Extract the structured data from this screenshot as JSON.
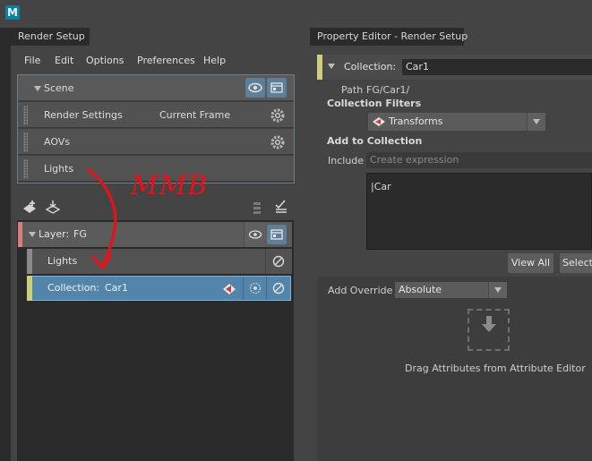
{
  "app": {
    "logo_letter": "M"
  },
  "tabs": {
    "render_setup": "Render Setup",
    "property_editor": "Property Editor - Render Setup"
  },
  "menu": [
    "File",
    "Edit",
    "Options",
    "Preferences",
    "Help"
  ],
  "scene": {
    "label": "Scene",
    "rows": [
      {
        "label": "Render Settings",
        "value": "Current Frame"
      },
      {
        "label": "AOVs"
      },
      {
        "label": "Lights"
      }
    ]
  },
  "annotation": {
    "text": "MMB",
    "color": "#e8101a"
  },
  "layers": {
    "layer_prefix": "Layer:",
    "layer_name": "FG",
    "sub_lights": "Lights",
    "collection_prefix": "Collection:",
    "collection_name": "Car1"
  },
  "property_editor": {
    "collection_label": "Collection:",
    "collection_value": "Car1",
    "path_label": "Path",
    "path_value": "FG/Car1/",
    "collection_filters_title": "Collection Filters",
    "filter_value": "Transforms",
    "add_to_collection_title": "Add to Collection",
    "include_label": "Include",
    "include_placeholder": "Create expression",
    "expression_text": "|Car",
    "view_all_button": "View All",
    "select_button": "Select",
    "add_override_label": "Add Override",
    "override_value": "Absolute",
    "drag_hint": "Drag Attributes from Attribute Editor"
  },
  "colors": {
    "selected_row": "#5285a9",
    "layer_marker": "#d67e7e",
    "collection_marker": "#cfcf7b"
  }
}
